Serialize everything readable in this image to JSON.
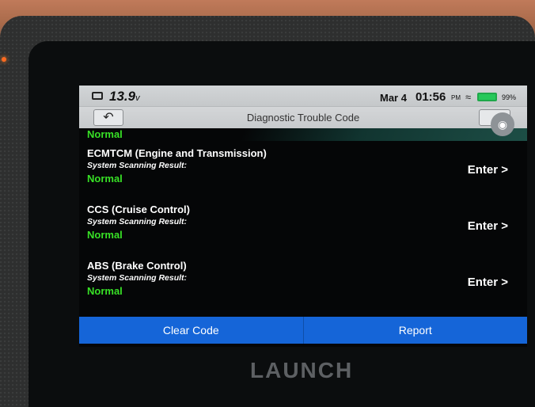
{
  "device": {
    "brand": "LAUNCH"
  },
  "statusbar": {
    "voltage": "13.9",
    "voltage_unit": "v",
    "date": "Mar 4",
    "time": "01:56",
    "ampm": "PM",
    "battery_percent": "99%"
  },
  "titlebar": {
    "title": "Diagnostic Trouble Code"
  },
  "top_status": "Normal",
  "systems": [
    {
      "name": "ECMTCM (Engine and Transmission)",
      "result_label": "System Scanning Result:",
      "status": "Normal",
      "action": "Enter >"
    },
    {
      "name": "CCS (Cruise Control)",
      "result_label": "System Scanning Result:",
      "status": "Normal",
      "action": "Enter >"
    },
    {
      "name": "ABS (Brake Control)",
      "result_label": "System Scanning Result:",
      "status": "Normal",
      "action": "Enter >"
    }
  ],
  "buttons": {
    "clear_code": "Clear Code",
    "report": "Report"
  },
  "colors": {
    "status_ok": "#38e026",
    "action_bar": "#1565d8"
  }
}
